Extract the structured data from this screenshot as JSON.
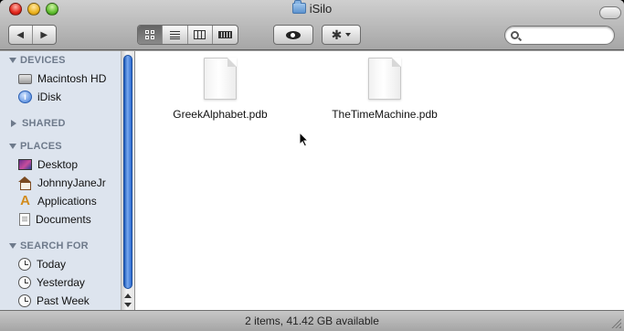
{
  "window": {
    "title": "iSilo",
    "title_icon": "folder-icon"
  },
  "toolbar": {
    "back_icon": "back-arrow-icon",
    "forward_icon": "forward-arrow-icon",
    "back_glyph": "◀",
    "forward_glyph": "▶",
    "view_modes": [
      "icon",
      "list",
      "columns",
      "cover-flow"
    ],
    "active_view": "icon",
    "quicklook_icon": "eye-icon",
    "action_icon": "gear-icon",
    "gear_glyph": "✱",
    "search": {
      "value": "",
      "placeholder": ""
    }
  },
  "sidebar": {
    "sections": [
      {
        "label": "DEVICES",
        "expanded": true,
        "items": [
          {
            "label": "Macintosh HD",
            "icon": "hard-drive-icon"
          },
          {
            "label": "iDisk",
            "icon": "idisk-icon"
          }
        ]
      },
      {
        "label": "SHARED",
        "expanded": false,
        "items": []
      },
      {
        "label": "PLACES",
        "expanded": true,
        "items": [
          {
            "label": "Desktop",
            "icon": "desktop-icon"
          },
          {
            "label": "JohnnyJaneJr",
            "icon": "home-icon"
          },
          {
            "label": "Applications",
            "icon": "applications-icon"
          },
          {
            "label": "Documents",
            "icon": "documents-icon"
          }
        ]
      },
      {
        "label": "SEARCH FOR",
        "expanded": true,
        "items": [
          {
            "label": "Today",
            "icon": "clock-icon"
          },
          {
            "label": "Yesterday",
            "icon": "clock-icon"
          },
          {
            "label": "Past Week",
            "icon": "clock-icon"
          }
        ]
      }
    ],
    "idisk_glyph": "i",
    "apps_glyph": "A"
  },
  "content": {
    "files": [
      {
        "name": "GreekAlphabet.pdb",
        "icon": "document-icon"
      },
      {
        "name": "TheTimeMachine.pdb",
        "icon": "document-icon"
      }
    ]
  },
  "status": {
    "text": "2 items, 41.42 GB available"
  }
}
